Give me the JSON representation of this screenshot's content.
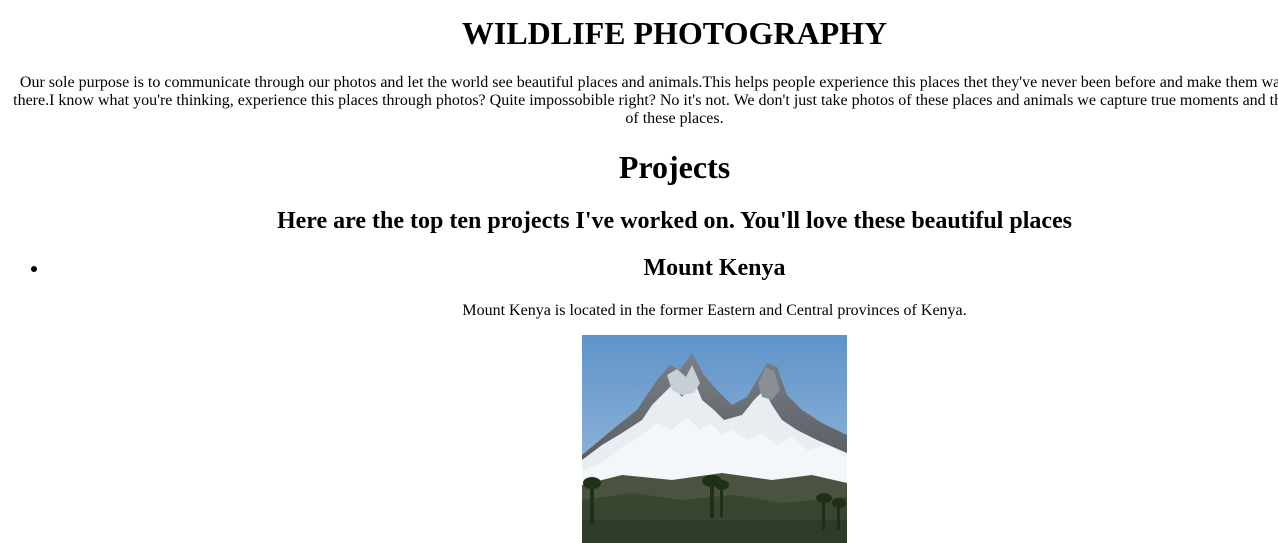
{
  "header": {
    "title": "WILDLIFE PHOTOGRAPHY",
    "intro": "Our sole purpose is to communicate through our photos and let the world see beautiful places and animals.This helps people experience this places thet they've never been before and make them want to go there.I know what you're thinking, experience this places through photos? Quite impossobible right? No it's not. We don't just take photos of these places and animals we capture true moments and the beauty of these places."
  },
  "projects": {
    "title": "Projects",
    "subtitle": "Here are the top ten projects I've worked on. You'll love these beautiful places",
    "items": [
      {
        "name": "Mount Kenya",
        "description": "Mount Kenya is located in the former Eastern and Central provinces of Kenya."
      }
    ]
  }
}
